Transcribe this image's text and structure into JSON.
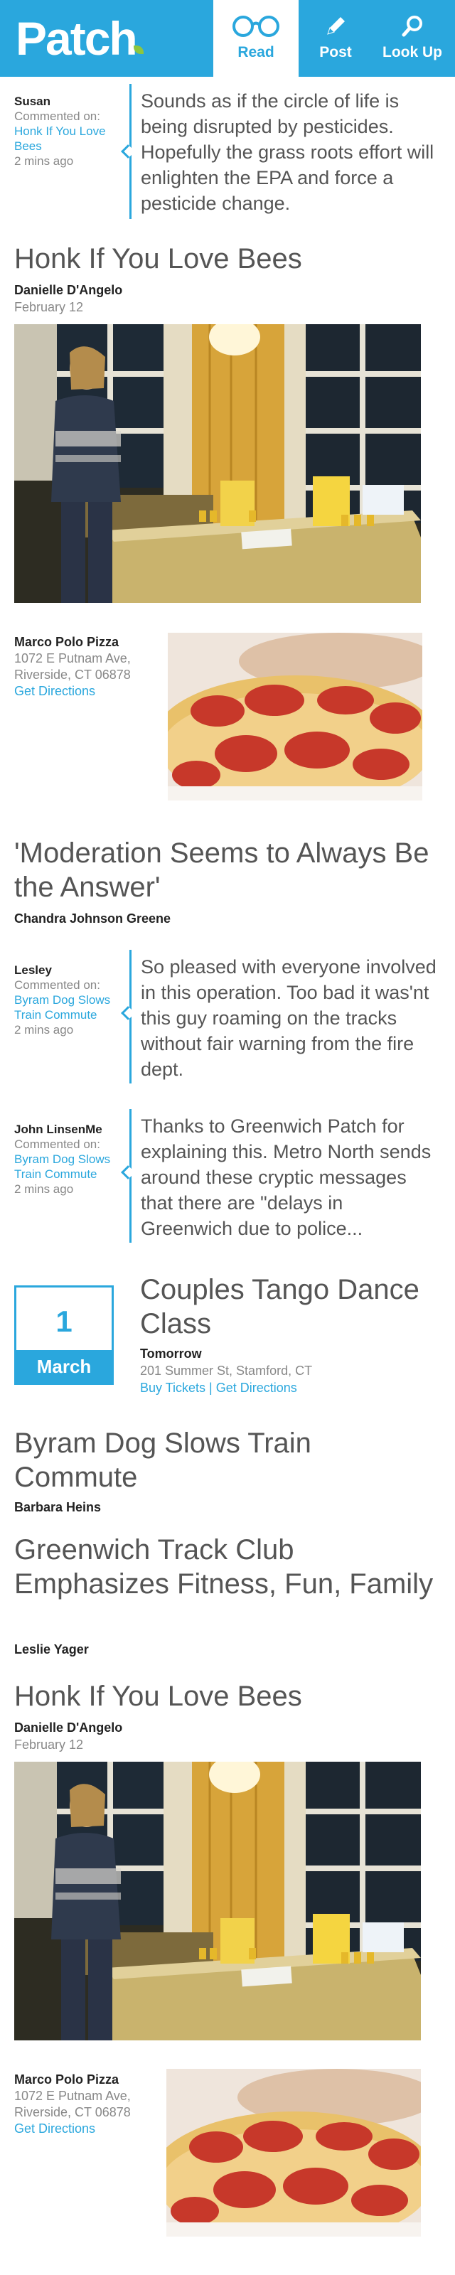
{
  "header": {
    "logo": "Patch",
    "nav": [
      {
        "label": "Read",
        "icon": "glasses-icon",
        "active": true
      },
      {
        "label": "Post",
        "icon": "pencil-icon",
        "active": false
      },
      {
        "label": "Look Up",
        "icon": "search-icon",
        "active": false
      }
    ],
    "colors": {
      "brand": "#2aa7dd",
      "accent": "#8cc63f"
    }
  },
  "comments": [
    {
      "author": "Susan",
      "commented_on_label": "Commented on:",
      "article": "Honk If You Love Bees",
      "time": "2 mins ago",
      "text": "Sounds as if the circle of life is being disrupted by pesticides. Hopefully the grass roots effort will enlighten the EPA and force a pesticide change."
    },
    {
      "author": "Lesley",
      "commented_on_label": "Commented on:",
      "article": "Byram Dog Slows Train Commute",
      "time": "2 mins ago",
      "text": "So pleased with everyone involved in this operation. Too bad it was'nt this guy roaming on the tracks without fair warning from the fire dept."
    },
    {
      "author": "John LinsenMe",
      "commented_on_label": "Commented on:",
      "article": "Byram Dog Slows Train Commute",
      "time": "2 mins ago",
      "text": "Thanks to Greenwich Patch for explaining this. Metro North sends around these cryptic messages that there are \"delays in Greenwich due to police..."
    }
  ],
  "articles": [
    {
      "title": "Honk If You Love Bees",
      "author": "Danielle D'Angelo",
      "date": "February 12"
    },
    {
      "title": "'Moderation Seems to Always Be the Answer'",
      "author": "Chandra Johnson Greene"
    },
    {
      "title": "Byram Dog Slows Train Commute",
      "author": "Barbara Heins"
    },
    {
      "title": "Greenwich Track Club Emphasizes Fitness, Fun, Family",
      "author": "Leslie Yager"
    },
    {
      "title": "Honk If You Love Bees",
      "author": "Danielle D'Angelo",
      "date": "February 12"
    }
  ],
  "ads": [
    {
      "name": "Marco Polo Pizza",
      "address": "1072 E Putnam Ave, Riverside, CT 06878",
      "link": "Get Directions"
    },
    {
      "name": "Marco Polo Pizza",
      "address": "1072 E Putnam Ave, Riverside, CT 06878",
      "link": "Get Directions"
    }
  ],
  "event": {
    "day": "1",
    "month": "March",
    "title": "Couples Tango Dance Class",
    "when": "Tomorrow",
    "where": "201 Summer St, Stamford, CT",
    "buy_tickets": "Buy Tickets",
    "separator": "|",
    "directions": "Get Directions"
  }
}
